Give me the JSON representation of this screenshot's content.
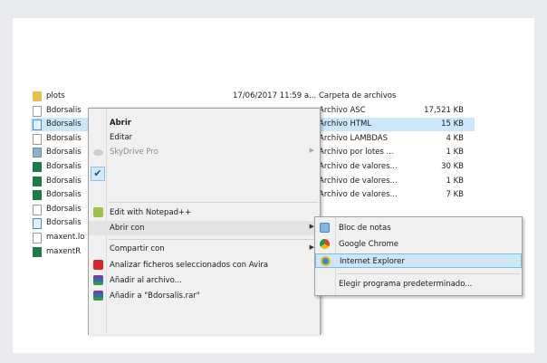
{
  "files": [
    {
      "name": "plots",
      "date": "17/06/2017 11:59 a...",
      "type": "Carpeta de archivos",
      "size": "",
      "icon": "folder-icon",
      "selected": false
    },
    {
      "name": "Bdorsalis",
      "date": "",
      "type": "Archivo ASC",
      "size": "17,521 KB",
      "icon": "file-icon",
      "selected": false
    },
    {
      "name": "Bdorsalis",
      "date": "",
      "type": "Archivo HTML",
      "size": "15 KB",
      "icon": "html-file-icon",
      "selected": true
    },
    {
      "name": "Bdorsalis",
      "date": "",
      "type": "Archivo LAMBDAS",
      "size": "4 KB",
      "icon": "file-icon",
      "selected": false
    },
    {
      "name": "Bdorsalis",
      "date": "",
      "type": "Archivo por lotes ...",
      "size": "1 KB",
      "icon": "batch-file-icon",
      "selected": false
    },
    {
      "name": "Bdorsalis",
      "date": "",
      "type": "Archivo de valores...",
      "size": "30 KB",
      "icon": "excel-file-icon",
      "selected": false
    },
    {
      "name": "Bdorsalis",
      "date": "",
      "type": "Archivo de valores...",
      "size": "1 KB",
      "icon": "excel-file-icon",
      "selected": false
    },
    {
      "name": "Bdorsalis",
      "date": "",
      "type": "Archivo de valores...",
      "size": "7 KB",
      "icon": "excel-file-icon",
      "selected": false
    },
    {
      "name": "Bdorsalis",
      "date": "",
      "type": "",
      "size": "",
      "icon": "file-icon",
      "selected": false
    },
    {
      "name": "Bdorsalis",
      "date": "",
      "type": "",
      "size": "",
      "icon": "html-file-icon",
      "selected": false
    },
    {
      "name": "maxent.lo",
      "date": "",
      "type": "",
      "size": "",
      "icon": "file-icon",
      "selected": false
    },
    {
      "name": "maxentR",
      "date": "",
      "type": "",
      "size": "",
      "icon": "excel-file-icon",
      "selected": false
    }
  ],
  "context_menu": {
    "items": [
      {
        "label": "Abrir",
        "bold": true
      },
      {
        "label": "Editar"
      },
      {
        "label": "SkyDrive Pro",
        "disabled": true,
        "submenu": true,
        "icon": "skydrive-icon"
      },
      {
        "label": "Edit with Notepad++",
        "icon": "notepad-plus-plus-icon"
      },
      {
        "label": "Abrir con",
        "submenu": true,
        "highlighted": true
      },
      {
        "label": "Compartir con",
        "submenu": true
      },
      {
        "label": "Analizar ficheros seleccionados con Avira",
        "icon": "avira-icon"
      },
      {
        "label": "Añadir al archivo...",
        "icon": "winrar-icon"
      },
      {
        "label": "Añadir a \"Bdorsalis.rar\"",
        "icon": "winrar-icon"
      }
    ],
    "check_mark": "✔"
  },
  "open_with_menu": {
    "items": [
      {
        "label": "Bloc de notas",
        "icon": "notepad-icon"
      },
      {
        "label": "Google Chrome",
        "icon": "chrome-icon"
      },
      {
        "label": "Internet Explorer",
        "icon": "internet-explorer-icon",
        "highlighted": true
      },
      {
        "label": "Elegir programa predeterminado..."
      }
    ]
  },
  "colors": {
    "selection": "#cce6fa",
    "menu_bg": "#f0f0f0",
    "submenu_highlight": "#cde8fb"
  }
}
